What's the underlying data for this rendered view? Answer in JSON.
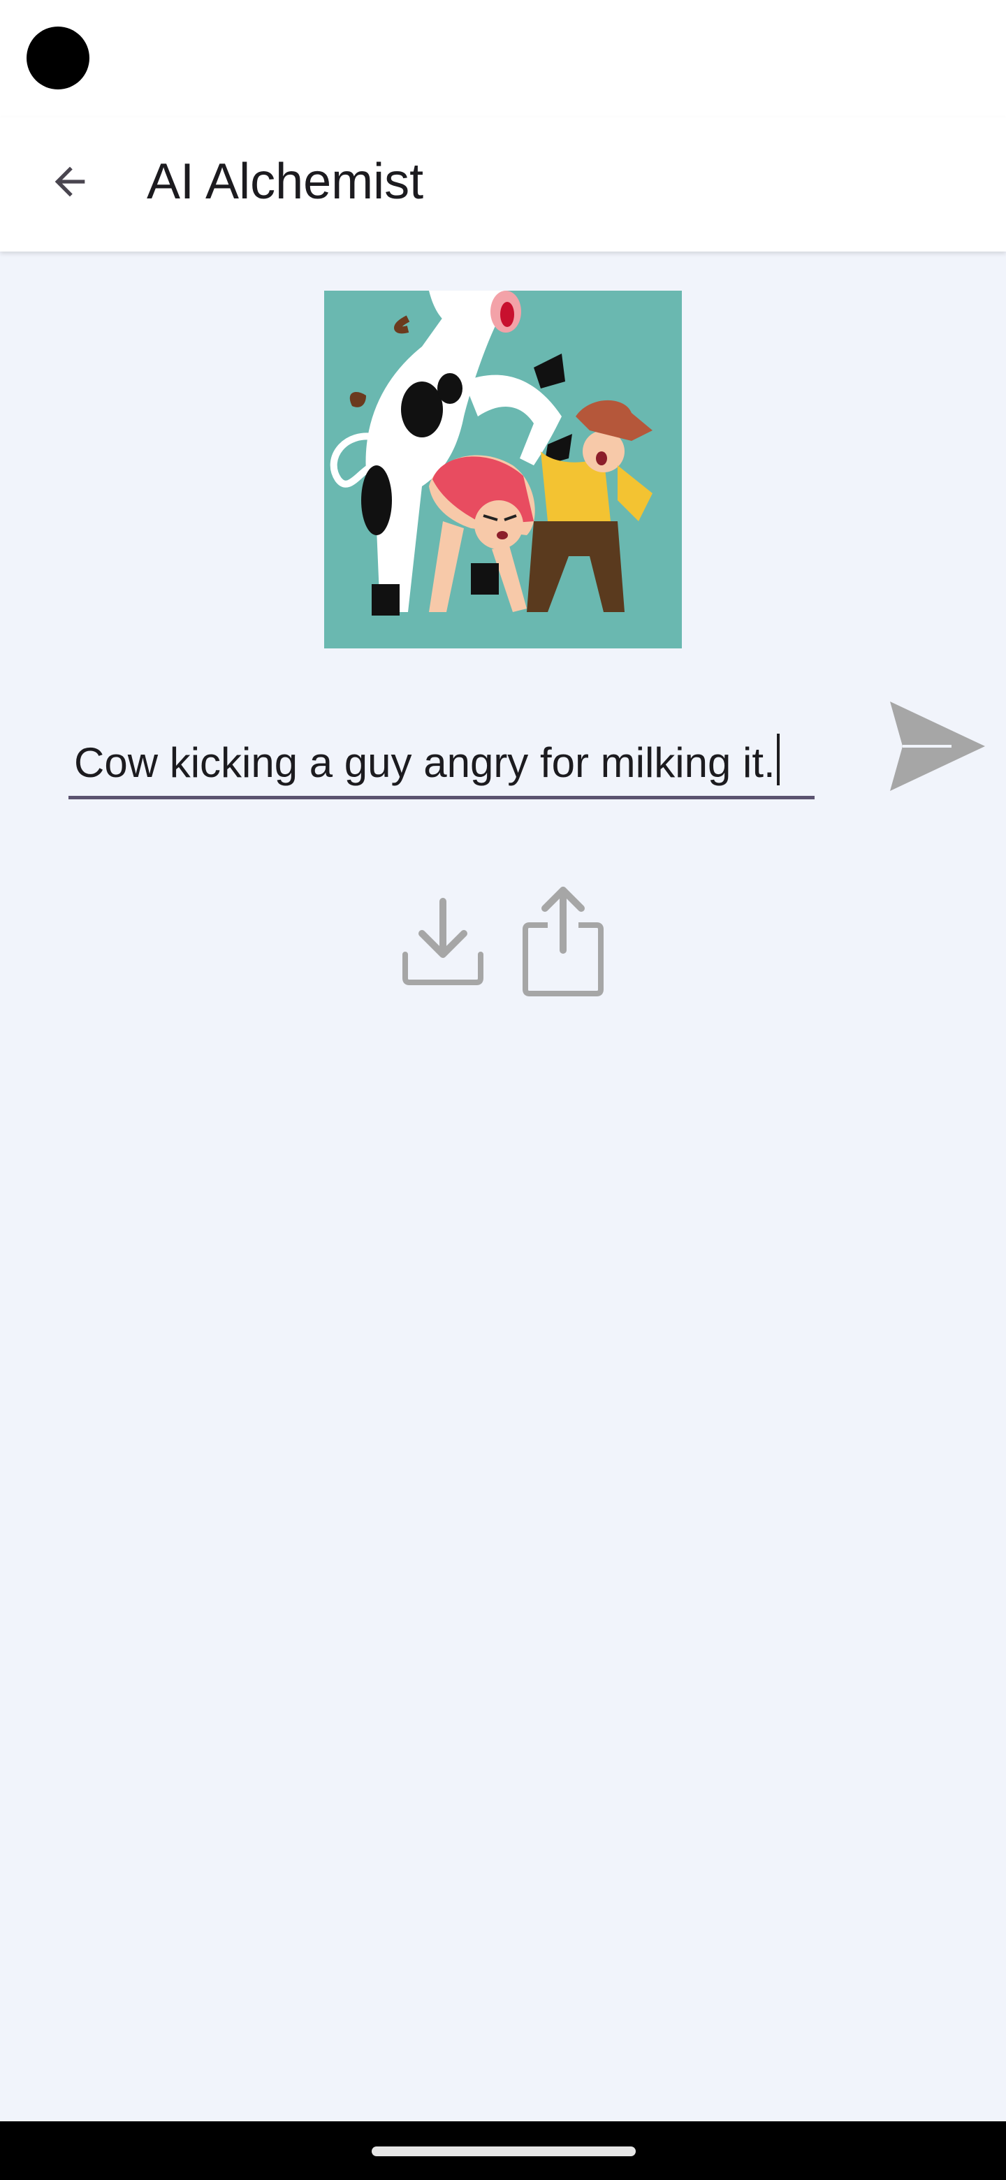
{
  "app_bar": {
    "title": "AI Alchemist",
    "back_icon": "arrow-back-icon"
  },
  "generated_image": {
    "description_icon": "generated-illustration"
  },
  "prompt": {
    "value": "Cow kicking a guy angry for milking it."
  },
  "actions": {
    "send_icon": "send-icon",
    "download_icon": "download-icon",
    "share_icon": "share-icon"
  },
  "colors": {
    "background": "#f1f4fb",
    "app_bar": "#ffffff",
    "image_background": "#6ab8b0",
    "underline": "#5b5370",
    "icon_gray": "#a6a6a6"
  }
}
